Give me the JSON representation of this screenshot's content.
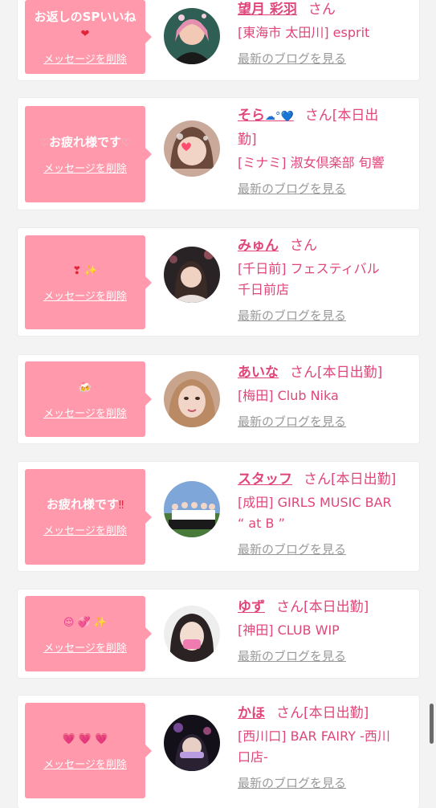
{
  "delete_label": "メッセージを削除",
  "blog_label": "最新のブログを見る",
  "san_label": "さん",
  "cards": [
    {
      "message": "お返しのSPいいね",
      "message_emoji": "❤",
      "name": "望月 彩羽",
      "status": "",
      "shop_lines": [
        "[東海市 太田川] esprit"
      ]
    },
    {
      "message": "お疲れ様です",
      "name": "そら",
      "name_emoji": "☁°💙",
      "status": "[本日出",
      "status_wrap": "勤]",
      "shop_lines": [
        "[ミナミ] 淑女倶楽部 旬響"
      ]
    },
    {
      "message": "",
      "message_emoji": "❣ ✨",
      "name": "みゅん",
      "status": "",
      "shop_lines": [
        "[千日前] フェスティバル",
        "千日前店"
      ]
    },
    {
      "message": "",
      "message_emoji": "🍻",
      "name": "あいな",
      "status": "[本日出勤]",
      "shop_lines": [
        "[梅田] Club Nika"
      ]
    },
    {
      "message": "お疲れ様です",
      "message_emoji": "‼",
      "name": "スタッフ",
      "status": "[本日出勤]",
      "shop_lines": [
        "[成田] GIRLS MUSIC BAR",
        "“ at B ”"
      ]
    },
    {
      "message": "",
      "message_emoji": "😌 💞 ✨",
      "name": "ゆず",
      "status": "[本日出勤]",
      "shop_lines": [
        "[神田] CLUB WIP"
      ]
    },
    {
      "message": "",
      "message_emoji": "💗 💗 💗",
      "name": "かほ",
      "status": "[本日出勤]",
      "shop_lines": [
        "[西川口] BAR FAIRY -西川",
        "口店-"
      ]
    }
  ],
  "colors": {
    "bubble": "#ff99ab",
    "accent": "#e0457b",
    "link_gray": "#999999",
    "background": "#f3f3f3"
  }
}
